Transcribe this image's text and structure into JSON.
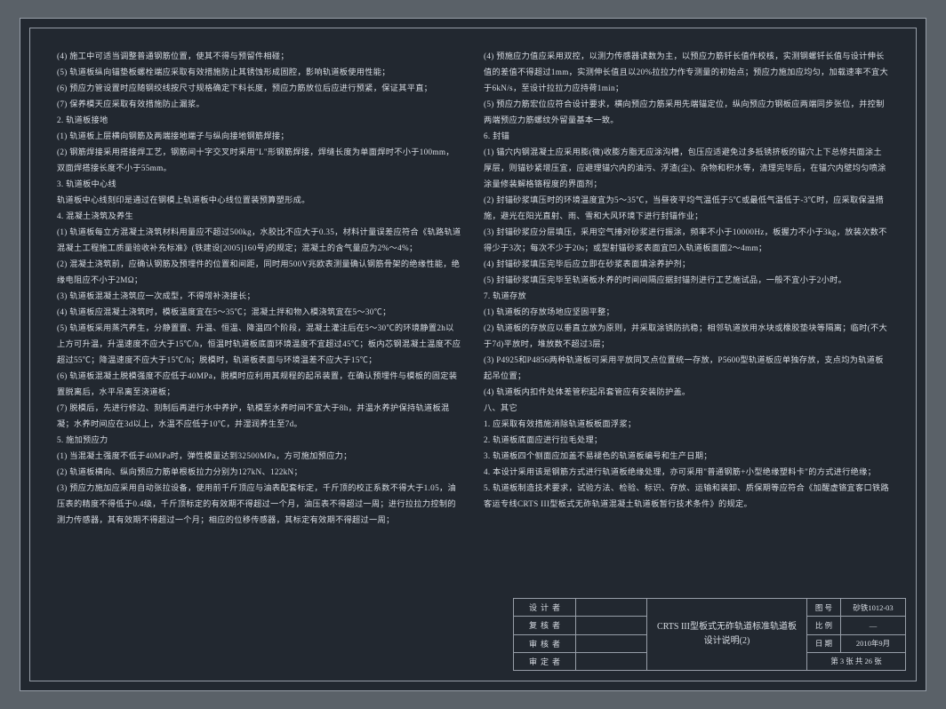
{
  "left_column": [
    "(4) 施工中可适当调整普通钢筋位置，使其不得与预留件相碰；",
    "(5) 轨道板纵向锚垫板螺栓端应采取有效措施防止其锈蚀形成固腔，影响轨道板使用性能；",
    "(6) 预应力管设置时应随钢绞线按尺寸规格确定下料长度，预应力筋放位后应进行预紧，保证其平直；",
    "(7) 保养模天应采取有效措施防止漏浆。",
    "2. 轨道板接地",
    "(1) 轨道板上层横向钢筋及两端接地端子与纵向接地钢筋焊接；",
    "(2) 钢筋焊接采用搭接焊工艺，钢筋间十字交叉时采用\"L\"形钢筋焊接，焊缝长度为单面焊时不小于100mm，双面焊搭接长度不小于55mm。",
    "3. 轨道板中心线",
    "    轨道板中心线刻印是通过在钢模上轨道板中心线位置装预算塑形成。",
    "4. 混凝土浇筑及养生",
    "(1) 轨道板每立方混凝土浇筑材料用量应不超过500kg，水胶比不应大于0.35，材料计量误差应符合《轨路轨道混凝土工程施工质量验收补充标准》(铁建设[2005]160号)的规定；混凝土的含气量应为2%～4%；",
    "(2) 混凝土浇筑前，应确认钢筋及预埋件的位置和间距，同时用500V兆欧表测量确认钢筋骨架的绝缘性能，绝缘电阻应不小于2MΩ；",
    "(3) 轨道板混凝土浇筑应一次成型，不得增补浇接长；",
    "(4) 轨道板应混凝土浇筑时，模板温度宜在5～35℃；混凝土拌和物入模浇筑宜在5～30℃；",
    "(5) 轨道板采用蒸汽养生，分静置置、升温、恒温、降温四个阶段，混凝土灌注后在5～30℃的环境静置2h以上方可升温，升温速度不应大于15℃/h，恒温时轨道板底面环境温度不宜超过45℃；板内芯钢混凝土温度不应超过55℃；降温速度不应大于15℃/h；脱模时，轨道板表面与环境温差不应大于15℃；",
    "(6) 轨道板混凝土脱模强度不应低于40MPa，脱模时应利用其规程的起吊装置，在确认预埋件与模板的固定装置脱离后，水平吊离至浇道板；",
    "(7) 脱模后，先进行修边、刻制后再进行水中养护，轨模至水养时间不宜大于8h，并温水养护保持轨道板混凝；水养时间应在3d以上，水温不应低于10℃，并湿润养生至7d。",
    "5. 施加预应力",
    "(1) 当混凝土强度不低于40MPa时，弹性模量达到32500MPa，方可施加预应力；",
    "(2) 轨道板横向、纵向预应力筋单根板拉力分别为127kN、122kN；",
    "(3) 预应力施加应采用自动张拉设备，使用前千斤顶应与油表配套标定，千斤顶的校正系数不得大于1.05，油压表的精度不得低于0.4级，千斤顶标定的有效期不得超过一个月，油压表不得超过一周；进行拉拉力控制的测力传感器，其有效期不得超过一个月；相应的位移传感器，其标定有效期不得超过一周；"
  ],
  "right_column": [
    "(4) 预施应力值应采用双控，以测力传感器读数为主，以预应力筋钎长值作校核，实测钢螺钎长值与设计伸长值的差值不得超过1mm，实测伸长值且以20%拉拉力作专测量的初始点；预应力施加应均匀，加载速率不宜大于6kN/s，至设计拉拉力应持荷1min；",
    "(5) 预应力筋宏位应符合设计要求，横向预应力筋采用先端锚定位，纵向预应力钢板应两端同步张位，并控制两端预应力筋螺纹外留量基本一致。",
    "6. 封锚",
    "(1) 锚穴内钢混凝土应采用膨(微)收膨方脂无应涂沟槽，包压应适避免过多抵锈挤板的锚穴上下总修共面涂土厚层，则锚钞紧增压宜，应避理锚穴内的油污、浮渣(尘)、杂物和积水等，清理完毕后，在锚穴内壁均匀喷涂涂量修装解格铬程度的界面剂；",
    "(2) 封锚砂浆填压时的环境温度宜为5～35℃，当昼夜平均气温低于5℃或最低气温低于-3℃时，应采取保温措施，避光在阳光直射、雨、雪和大风环境下进行封锚作业；",
    "(3) 封锚砂浆应分层填压，采用空气捶对砂浆进行振涂，频率不小于10000Hz，板握力不小于3kg，放装次数不得少于3次；每次不少于20s；或型射锚砂浆表面宜凹入轨道板面面2～4mm；",
    "(4) 封锚砂浆填压完毕后应立即在砂浆表面填涂养护剂；",
    "(5) 封锚砂浆填压完毕至轨道板水养的时间间隔应据封锚剂进行工艺施试品，一般不宜小于2小时。",
    "7. 轨道存放",
    "(1) 轨道板的存放场地应坚固平整；",
    "(2) 轨道板的存放应以垂直立放为原则，并采取涂锈防抗稳；相邻轨道放用水块或橡胶垫块等隔离；临时(不大于7d)平放时，堆放数不超过3层；",
    "(3) P4925和P4856两种轨道板可采用平放同叉点位置统一存放，P5600型轨道板应单独存放，支点均为轨道板起吊位置；",
    "(4) 轨道板内扣件处体差管积起吊套管应有安装防护盖。",
    "八、其它",
    "1. 应采取有效措施消除轨道板板面浮浆；",
    "2. 轨道板底面应进行拉毛处理；",
    "3. 轨道板四个侧面应加盖不易褪色的轨道板编号和生产日期；",
    "4. 本设计采用该是钢筋方式进行轨道板绝缘处理，亦可采用\"普通钢筋+小型绝缘塑料卡\"的方式进行绝缘；",
    "5. 轨道板制造技术要求，试验方法、检验、标识、存放、运输和装卸、质保期等应符合《加醒虚铬宜客口铁路客运专线CRTS III型板式无砟轨道混凝土轨道板暂行技术条件》的规定。"
  ],
  "titleblock": {
    "designer_label": "设计者",
    "reviewer_label": "复核者",
    "checker_label": "审核者",
    "approver_label": "审定者",
    "title_text": "CRTS III型板式无砟轨道标准轨道板\n设计说明(2)",
    "drawing_no_label": "图 号",
    "drawing_no": "砂铁1012-03",
    "scale_label": "比 例",
    "scale": "—",
    "date_label": "日 期",
    "date": "2010年9月",
    "sheet": "第 3 张 共 26 张"
  }
}
